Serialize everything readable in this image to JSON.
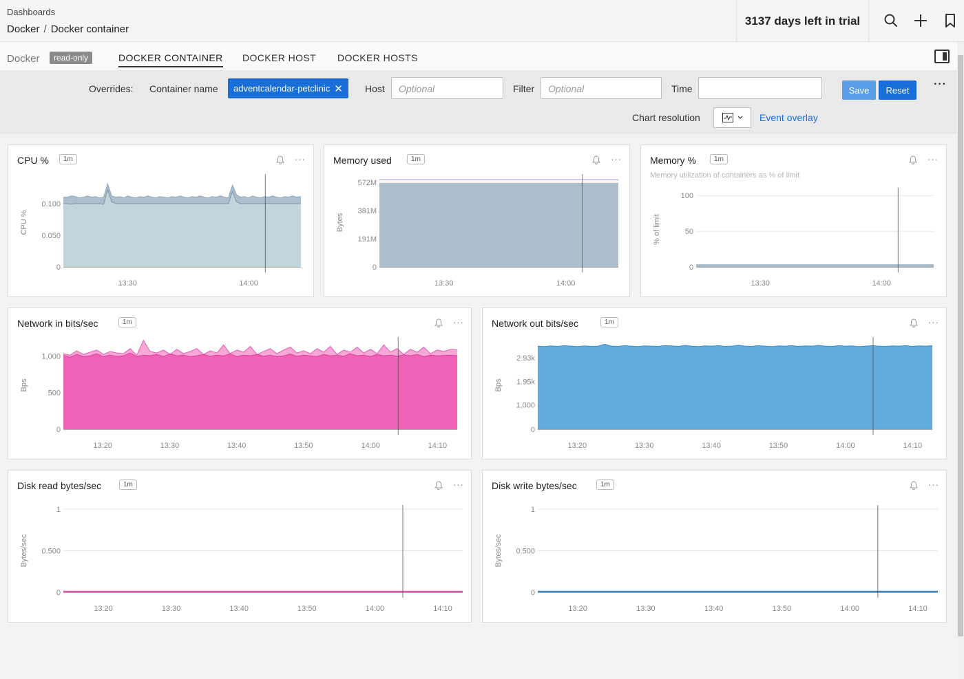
{
  "header": {
    "breadcrumb_root": "Dashboards",
    "path_parent": "Docker",
    "path_separator": "/",
    "path_current": "Docker container",
    "trial_text": "3137 days left in trial",
    "icons": [
      "search-icon",
      "plus-icon",
      "bookmark-icon"
    ]
  },
  "tabs": {
    "group_label": "Docker",
    "badge": "read-only",
    "items": [
      "DOCKER CONTAINER",
      "DOCKER HOST",
      "DOCKER HOSTS"
    ],
    "active_index": 0
  },
  "filters": {
    "overrides_label": "Overrides:",
    "container_label": "Container name",
    "container_value": "adventcalendar-petclinic",
    "host_label": "Host",
    "host_placeholder": "Optional",
    "filter_label": "Filter",
    "filter_placeholder": "Optional",
    "time_label": "Time",
    "time_value": "",
    "save_label": "Save",
    "reset_label": "Reset",
    "resolution_label": "Chart resolution",
    "event_overlay_label": "Event overlay"
  },
  "colors": {
    "gray_series": "#a9bccb",
    "gray_top": "#c5d5dd",
    "pink_series": "#f05db4",
    "pink_top": "#f7a3d4",
    "blue_series": "#5aa7da",
    "purple_line": "#b48ad0",
    "accent": "#1a6ed8"
  },
  "tiles": [
    {
      "title": "CPU %",
      "badge": "1m"
    },
    {
      "title": "Memory used",
      "badge": "1m"
    },
    {
      "title": "Memory %",
      "badge": "1m",
      "subtitle": "Memory utilization of containers as % of limit"
    },
    {
      "title": "Network in bits/sec",
      "badge": "1m"
    },
    {
      "title": "Network out bits/sec",
      "badge": "1m"
    },
    {
      "title": "Disk read bytes/sec",
      "badge": "1m"
    },
    {
      "title": "Disk write bytes/sec",
      "badge": "1m"
    }
  ],
  "chart_data": [
    {
      "type": "area",
      "title": "CPU %",
      "ylabel": "CPU %",
      "ylim": [
        0,
        0.14
      ],
      "yticks": [
        {
          "v": 0,
          "l": "0"
        },
        {
          "v": 0.05,
          "l": "0.050"
        },
        {
          "v": 0.1,
          "l": "0.100"
        }
      ],
      "xticks": [
        "13:30",
        "14:00"
      ],
      "series": [
        {
          "values": [
            0.1,
            0.1,
            0.099,
            0.1,
            0.1,
            0.1,
            0.1,
            0.1,
            0.1,
            0.1,
            0.099,
            0.122,
            0.103,
            0.1,
            0.1,
            0.1,
            0.1,
            0.1,
            0.1,
            0.1,
            0.1,
            0.1,
            0.1,
            0.1,
            0.1,
            0.1,
            0.1,
            0.1,
            0.1,
            0.1,
            0.1,
            0.1,
            0.1,
            0.1,
            0.1,
            0.1,
            0.1,
            0.1,
            0.1,
            0.1,
            0.1,
            0.1,
            0.119,
            0.103,
            0.1,
            0.1,
            0.1,
            0.1,
            0.1,
            0.1,
            0.1,
            0.1,
            0.1,
            0.1,
            0.1,
            0.1,
            0.1,
            0.1,
            0.1,
            0.1
          ]
        },
        {
          "values": [
            0.11,
            0.11,
            0.112,
            0.111,
            0.109,
            0.11,
            0.112,
            0.11,
            0.111,
            0.109,
            0.11,
            0.131,
            0.112,
            0.11,
            0.111,
            0.109,
            0.112,
            0.11,
            0.109,
            0.111,
            0.11,
            0.112,
            0.11,
            0.109,
            0.111,
            0.11,
            0.109,
            0.111,
            0.11,
            0.112,
            0.11,
            0.109,
            0.111,
            0.11,
            0.112,
            0.11,
            0.109,
            0.111,
            0.11,
            0.112,
            0.11,
            0.109,
            0.129,
            0.114,
            0.11,
            0.111,
            0.109,
            0.112,
            0.11,
            0.109,
            0.111,
            0.11,
            0.112,
            0.11,
            0.109,
            0.111,
            0.11,
            0.112,
            0.11,
            0.111
          ]
        }
      ]
    },
    {
      "type": "area",
      "title": "Memory used",
      "ylabel": "Bytes",
      "ylim": [
        0,
        600
      ],
      "yticks": [
        {
          "v": 0,
          "l": "0"
        },
        {
          "v": 191,
          "l": "191M"
        },
        {
          "v": 381,
          "l": "381M"
        },
        {
          "v": 572,
          "l": "572M"
        }
      ],
      "xticks": [
        "13:30",
        "14:00"
      ],
      "series": [
        {
          "values": [
            565,
            565,
            565,
            565,
            565,
            565,
            565,
            565,
            565,
            565,
            565,
            565,
            565,
            565,
            565,
            565,
            565,
            565,
            565,
            565
          ]
        },
        {
          "values": [
            590,
            590,
            590,
            590,
            590,
            590,
            590,
            590,
            590,
            590,
            590,
            590,
            590,
            590,
            590,
            590,
            590,
            590,
            590,
            590
          ]
        }
      ]
    },
    {
      "type": "area",
      "title": "Memory %",
      "ylabel": "% of limit",
      "ylim": [
        0,
        105
      ],
      "yticks": [
        {
          "v": 0,
          "l": "0"
        },
        {
          "v": 50,
          "l": "50"
        },
        {
          "v": 100,
          "l": "100"
        }
      ],
      "xticks": [
        "13:30",
        "14:00"
      ],
      "series": [
        {
          "values": [
            3,
            3,
            3,
            3,
            3,
            3,
            3,
            3,
            3,
            3,
            3,
            3,
            3,
            3,
            3,
            3,
            3,
            3,
            3,
            3
          ]
        }
      ]
    },
    {
      "type": "area",
      "title": "Network in bits/sec",
      "ylabel": "Bps",
      "ylim": [
        0,
        1200
      ],
      "yticks": [
        {
          "v": 0,
          "l": "0"
        },
        {
          "v": 500,
          "l": "500"
        },
        {
          "v": 1000,
          "l": "1,000"
        }
      ],
      "xticks": [
        "13:20",
        "13:30",
        "13:40",
        "13:50",
        "14:00",
        "14:10"
      ],
      "series": [
        {
          "values": [
            1010,
            980,
            1020,
            990,
            1000,
            1030,
            990,
            1010,
            995,
            1000,
            1040,
            990,
            1010,
            1000,
            1020,
            990,
            1030,
            1000,
            1010,
            990,
            1000,
            1020,
            995,
            1010,
            1000,
            1030,
            990,
            1010,
            1000,
            1020,
            995,
            1010,
            990,
            1000,
            1025,
            995,
            1010,
            1000,
            990,
            1020,
            1000,
            1010,
            995,
            1030,
            1000,
            1010,
            990,
            1020,
            1000,
            1010,
            995,
            1015,
            1000,
            1020,
            990,
            1010,
            1000,
            1005,
            1010,
            1000
          ]
        },
        {
          "values": [
            1030,
            1010,
            1070,
            1020,
            1050,
            1080,
            1020,
            1060,
            1040,
            1030,
            1100,
            1010,
            1210,
            1060,
            1040,
            1080,
            1020,
            1090,
            1030,
            1060,
            1100,
            1020,
            1070,
            1040,
            1150,
            1030,
            1080,
            1050,
            1130,
            1020,
            1060,
            1100,
            1030,
            1080,
            1120,
            1040,
            1070,
            1030,
            1100,
            1050,
            1130,
            1020,
            1080,
            1050,
            1120,
            1040,
            1090,
            1030,
            1150,
            1050,
            1100,
            1020,
            1090,
            1050,
            1120,
            1030,
            1080,
            1060,
            1090,
            1080
          ]
        }
      ]
    },
    {
      "type": "area",
      "title": "Network out bits/sec",
      "ylabel": "Bps",
      "ylim": [
        0,
        3600
      ],
      "yticks": [
        {
          "v": 0,
          "l": "0"
        },
        {
          "v": 1000,
          "l": "1,000"
        },
        {
          "v": 1950,
          "l": "1.95k"
        },
        {
          "v": 2930,
          "l": "2.93k"
        }
      ],
      "xticks": [
        "13:20",
        "13:30",
        "13:40",
        "13:50",
        "14:00",
        "14:10"
      ],
      "series": [
        {
          "values": [
            3400,
            3380,
            3410,
            3390,
            3420,
            3400,
            3380,
            3410,
            3390,
            3400,
            3480,
            3400,
            3390,
            3420,
            3400,
            3380,
            3410,
            3400,
            3390,
            3420,
            3410,
            3390,
            3430,
            3400,
            3380,
            3410,
            3400,
            3420,
            3390,
            3400,
            3440,
            3400,
            3390,
            3420,
            3400,
            3380,
            3410,
            3400,
            3420,
            3390,
            3410,
            3400,
            3430,
            3400,
            3390,
            3420,
            3400,
            3410,
            3380,
            3400,
            3420,
            3400,
            3390,
            3410,
            3400,
            3420,
            3390,
            3410,
            3400,
            3420
          ]
        }
      ]
    },
    {
      "type": "line",
      "title": "Disk read bytes/sec",
      "ylabel": "Bytes/sec",
      "ylim": [
        0,
        1
      ],
      "yticks": [
        {
          "v": 0,
          "l": "0"
        },
        {
          "v": 0.5,
          "l": "0.500"
        },
        {
          "v": 1,
          "l": "1"
        }
      ],
      "xticks": [
        "13:20",
        "13:30",
        "13:40",
        "13:50",
        "14:00",
        "14:10"
      ],
      "series": [
        {
          "values": [
            0.01,
            0.01,
            0.01,
            0.01,
            0.01,
            0.01,
            0.01,
            0.01,
            0.01,
            0.01
          ]
        }
      ]
    },
    {
      "type": "line",
      "title": "Disk write bytes/sec",
      "ylabel": "Bytes/sec",
      "ylim": [
        0,
        1
      ],
      "yticks": [
        {
          "v": 0,
          "l": "0"
        },
        {
          "v": 0.5,
          "l": "0.500"
        },
        {
          "v": 1,
          "l": "1"
        }
      ],
      "xticks": [
        "13:20",
        "13:30",
        "13:40",
        "13:50",
        "14:00",
        "14:10"
      ],
      "series": [
        {
          "values": [
            0.01,
            0.01,
            0.01,
            0.01,
            0.01,
            0.01,
            0.01,
            0.01,
            0.01,
            0.01
          ]
        }
      ]
    }
  ]
}
